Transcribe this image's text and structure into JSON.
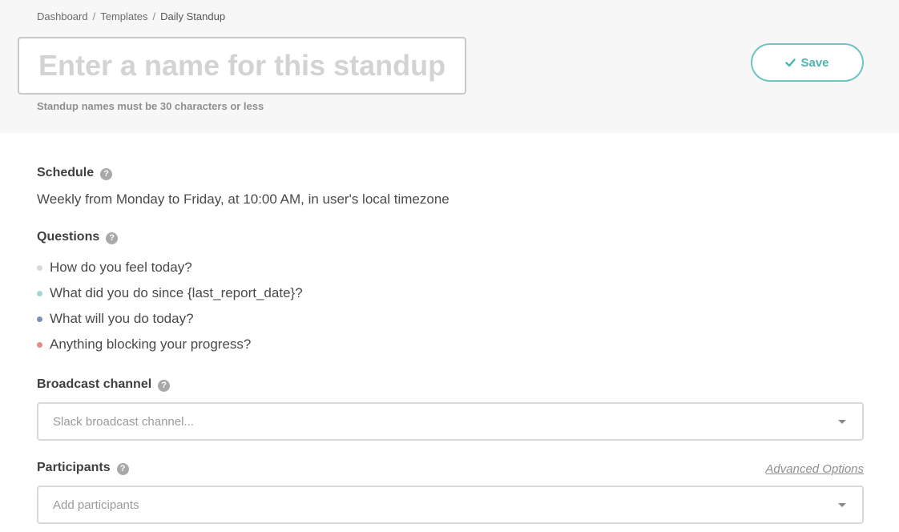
{
  "breadcrumb": {
    "items": [
      "Dashboard",
      "Templates"
    ],
    "current": "Daily Standup",
    "separator": "/"
  },
  "name_field": {
    "placeholder": "Enter a name for this standup...",
    "value": "",
    "hint": "Standup names must be 30 characters or less"
  },
  "save_button": {
    "label": "Save",
    "icon": "check-icon"
  },
  "schedule": {
    "label": "Schedule",
    "text": "Weekly from Monday to Friday, at 10:00 AM, in user's local timezone"
  },
  "questions": {
    "label": "Questions",
    "items": [
      {
        "text": "How do you feel today?",
        "color": "#d9d9d9"
      },
      {
        "text": "What did you do since {last_report_date}?",
        "color": "#a8d5d3"
      },
      {
        "text": "What will you do today?",
        "color": "#7d8fb5"
      },
      {
        "text": "Anything blocking your progress?",
        "color": "#e68a8a"
      }
    ]
  },
  "broadcast": {
    "label": "Broadcast channel",
    "placeholder": "Slack broadcast channel..."
  },
  "participants": {
    "label": "Participants",
    "placeholder": "Add participants",
    "advanced_link": "Advanced Options"
  },
  "colors": {
    "accent": "#4fb3b0",
    "accent_border": "#6ec5c2",
    "header_band": "#f7f7f7"
  }
}
